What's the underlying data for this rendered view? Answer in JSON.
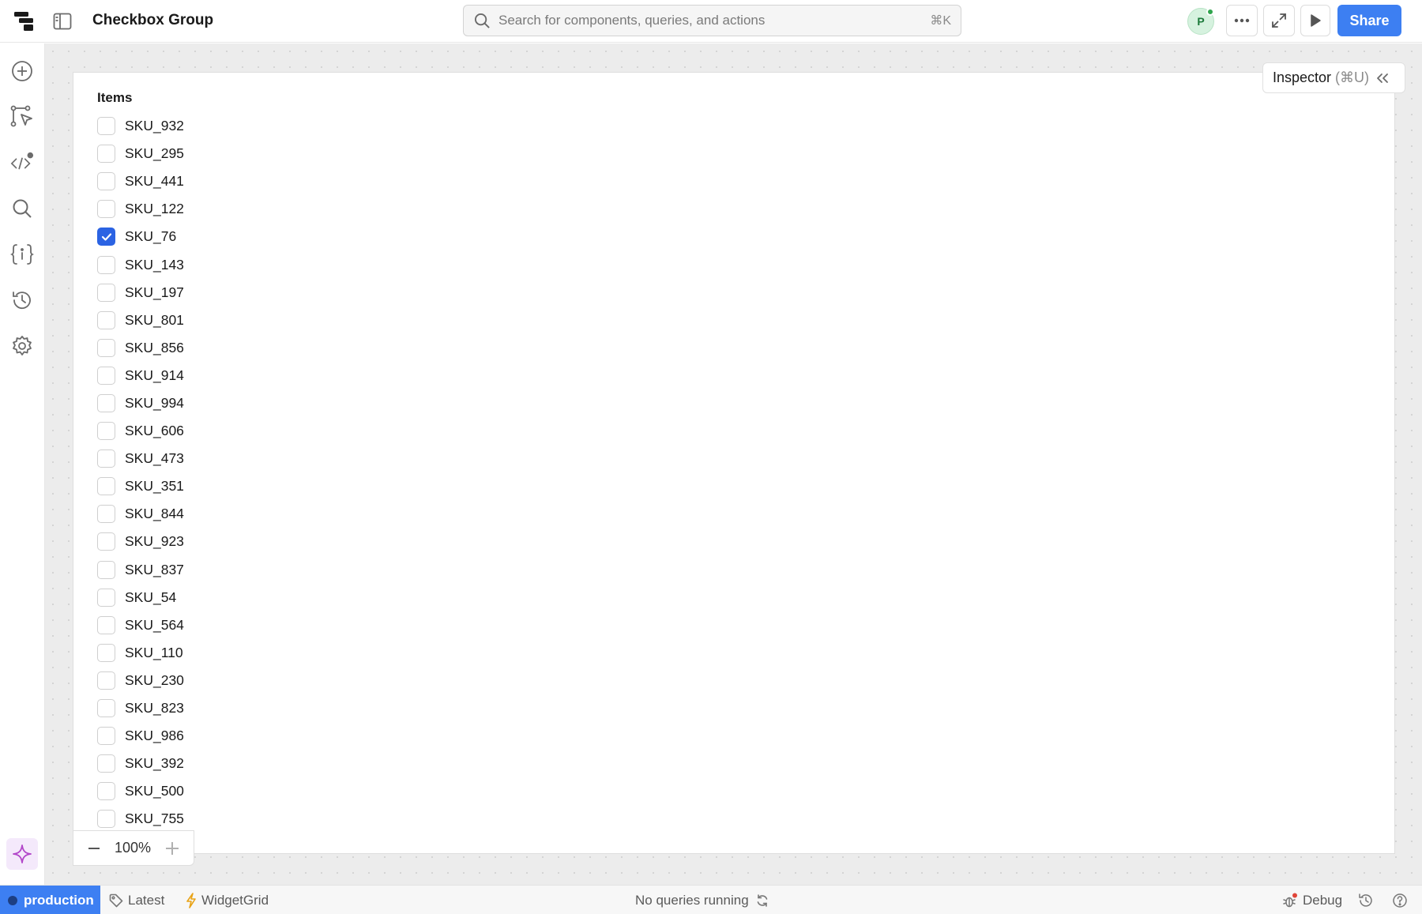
{
  "header": {
    "title": "Checkbox Group",
    "search_placeholder": "Search for components, queries, and actions",
    "search_shortcut": "⌘K",
    "avatar_initial": "P",
    "share_label": "Share"
  },
  "inspector": {
    "label": "Inspector",
    "shortcut": "(⌘U)"
  },
  "checkbox_group": {
    "label": "Items",
    "options": [
      {
        "label": "SKU_932",
        "checked": false
      },
      {
        "label": "SKU_295",
        "checked": false
      },
      {
        "label": "SKU_441",
        "checked": false
      },
      {
        "label": "SKU_122",
        "checked": false
      },
      {
        "label": "SKU_76",
        "checked": true
      },
      {
        "label": "SKU_143",
        "checked": false
      },
      {
        "label": "SKU_197",
        "checked": false
      },
      {
        "label": "SKU_801",
        "checked": false
      },
      {
        "label": "SKU_856",
        "checked": false
      },
      {
        "label": "SKU_914",
        "checked": false
      },
      {
        "label": "SKU_994",
        "checked": false
      },
      {
        "label": "SKU_606",
        "checked": false
      },
      {
        "label": "SKU_473",
        "checked": false
      },
      {
        "label": "SKU_351",
        "checked": false
      },
      {
        "label": "SKU_844",
        "checked": false
      },
      {
        "label": "SKU_923",
        "checked": false
      },
      {
        "label": "SKU_837",
        "checked": false
      },
      {
        "label": "SKU_54",
        "checked": false
      },
      {
        "label": "SKU_564",
        "checked": false
      },
      {
        "label": "SKU_110",
        "checked": false
      },
      {
        "label": "SKU_230",
        "checked": false
      },
      {
        "label": "SKU_823",
        "checked": false
      },
      {
        "label": "SKU_986",
        "checked": false
      },
      {
        "label": "SKU_392",
        "checked": false
      },
      {
        "label": "SKU_500",
        "checked": false
      },
      {
        "label": "SKU_755",
        "checked": false
      }
    ]
  },
  "zoom": {
    "value": "100%"
  },
  "status_bar": {
    "environment": "production",
    "version": "Latest",
    "widget": "WidgetGrid",
    "queries": "No queries running",
    "debug": "Debug"
  },
  "colors": {
    "accent": "#3d7ff2",
    "checked": "#2b63e3",
    "presence": "#2fa54d",
    "assistant": "#b246c9",
    "widget_icon": "#e8a317"
  },
  "icons": {
    "rail": [
      "add-circle-icon",
      "workflow-cursor-icon",
      "code-icon",
      "search-icon",
      "state-braces-icon",
      "history-clock-icon",
      "settings-gear-icon"
    ],
    "assistant": "sparkle-icon"
  }
}
